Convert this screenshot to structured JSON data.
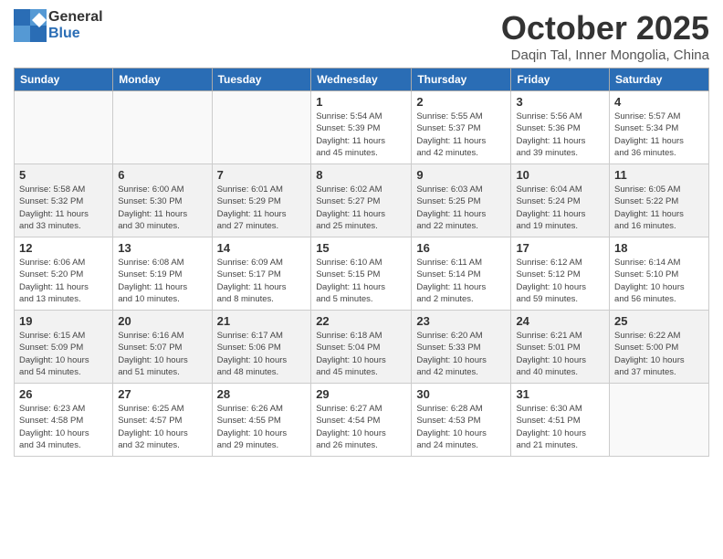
{
  "header": {
    "logo_general": "General",
    "logo_blue": "Blue",
    "month_title": "October 2025",
    "subtitle": "Daqin Tal, Inner Mongolia, China"
  },
  "weekdays": [
    "Sunday",
    "Monday",
    "Tuesday",
    "Wednesday",
    "Thursday",
    "Friday",
    "Saturday"
  ],
  "weeks": [
    [
      {
        "day": "",
        "info": ""
      },
      {
        "day": "",
        "info": ""
      },
      {
        "day": "",
        "info": ""
      },
      {
        "day": "1",
        "info": "Sunrise: 5:54 AM\nSunset: 5:39 PM\nDaylight: 11 hours\nand 45 minutes."
      },
      {
        "day": "2",
        "info": "Sunrise: 5:55 AM\nSunset: 5:37 PM\nDaylight: 11 hours\nand 42 minutes."
      },
      {
        "day": "3",
        "info": "Sunrise: 5:56 AM\nSunset: 5:36 PM\nDaylight: 11 hours\nand 39 minutes."
      },
      {
        "day": "4",
        "info": "Sunrise: 5:57 AM\nSunset: 5:34 PM\nDaylight: 11 hours\nand 36 minutes."
      }
    ],
    [
      {
        "day": "5",
        "info": "Sunrise: 5:58 AM\nSunset: 5:32 PM\nDaylight: 11 hours\nand 33 minutes."
      },
      {
        "day": "6",
        "info": "Sunrise: 6:00 AM\nSunset: 5:30 PM\nDaylight: 11 hours\nand 30 minutes."
      },
      {
        "day": "7",
        "info": "Sunrise: 6:01 AM\nSunset: 5:29 PM\nDaylight: 11 hours\nand 27 minutes."
      },
      {
        "day": "8",
        "info": "Sunrise: 6:02 AM\nSunset: 5:27 PM\nDaylight: 11 hours\nand 25 minutes."
      },
      {
        "day": "9",
        "info": "Sunrise: 6:03 AM\nSunset: 5:25 PM\nDaylight: 11 hours\nand 22 minutes."
      },
      {
        "day": "10",
        "info": "Sunrise: 6:04 AM\nSunset: 5:24 PM\nDaylight: 11 hours\nand 19 minutes."
      },
      {
        "day": "11",
        "info": "Sunrise: 6:05 AM\nSunset: 5:22 PM\nDaylight: 11 hours\nand 16 minutes."
      }
    ],
    [
      {
        "day": "12",
        "info": "Sunrise: 6:06 AM\nSunset: 5:20 PM\nDaylight: 11 hours\nand 13 minutes."
      },
      {
        "day": "13",
        "info": "Sunrise: 6:08 AM\nSunset: 5:19 PM\nDaylight: 11 hours\nand 10 minutes."
      },
      {
        "day": "14",
        "info": "Sunrise: 6:09 AM\nSunset: 5:17 PM\nDaylight: 11 hours\nand 8 minutes."
      },
      {
        "day": "15",
        "info": "Sunrise: 6:10 AM\nSunset: 5:15 PM\nDaylight: 11 hours\nand 5 minutes."
      },
      {
        "day": "16",
        "info": "Sunrise: 6:11 AM\nSunset: 5:14 PM\nDaylight: 11 hours\nand 2 minutes."
      },
      {
        "day": "17",
        "info": "Sunrise: 6:12 AM\nSunset: 5:12 PM\nDaylight: 10 hours\nand 59 minutes."
      },
      {
        "day": "18",
        "info": "Sunrise: 6:14 AM\nSunset: 5:10 PM\nDaylight: 10 hours\nand 56 minutes."
      }
    ],
    [
      {
        "day": "19",
        "info": "Sunrise: 6:15 AM\nSunset: 5:09 PM\nDaylight: 10 hours\nand 54 minutes."
      },
      {
        "day": "20",
        "info": "Sunrise: 6:16 AM\nSunset: 5:07 PM\nDaylight: 10 hours\nand 51 minutes."
      },
      {
        "day": "21",
        "info": "Sunrise: 6:17 AM\nSunset: 5:06 PM\nDaylight: 10 hours\nand 48 minutes."
      },
      {
        "day": "22",
        "info": "Sunrise: 6:18 AM\nSunset: 5:04 PM\nDaylight: 10 hours\nand 45 minutes."
      },
      {
        "day": "23",
        "info": "Sunrise: 6:20 AM\nSunset: 5:33 PM\nDaylight: 10 hours\nand 42 minutes."
      },
      {
        "day": "24",
        "info": "Sunrise: 6:21 AM\nSunset: 5:01 PM\nDaylight: 10 hours\nand 40 minutes."
      },
      {
        "day": "25",
        "info": "Sunrise: 6:22 AM\nSunset: 5:00 PM\nDaylight: 10 hours\nand 37 minutes."
      }
    ],
    [
      {
        "day": "26",
        "info": "Sunrise: 6:23 AM\nSunset: 4:58 PM\nDaylight: 10 hours\nand 34 minutes."
      },
      {
        "day": "27",
        "info": "Sunrise: 6:25 AM\nSunset: 4:57 PM\nDaylight: 10 hours\nand 32 minutes."
      },
      {
        "day": "28",
        "info": "Sunrise: 6:26 AM\nSunset: 4:55 PM\nDaylight: 10 hours\nand 29 minutes."
      },
      {
        "day": "29",
        "info": "Sunrise: 6:27 AM\nSunset: 4:54 PM\nDaylight: 10 hours\nand 26 minutes."
      },
      {
        "day": "30",
        "info": "Sunrise: 6:28 AM\nSunset: 4:53 PM\nDaylight: 10 hours\nand 24 minutes."
      },
      {
        "day": "31",
        "info": "Sunrise: 6:30 AM\nSunset: 4:51 PM\nDaylight: 10 hours\nand 21 minutes."
      },
      {
        "day": "",
        "info": ""
      }
    ]
  ]
}
